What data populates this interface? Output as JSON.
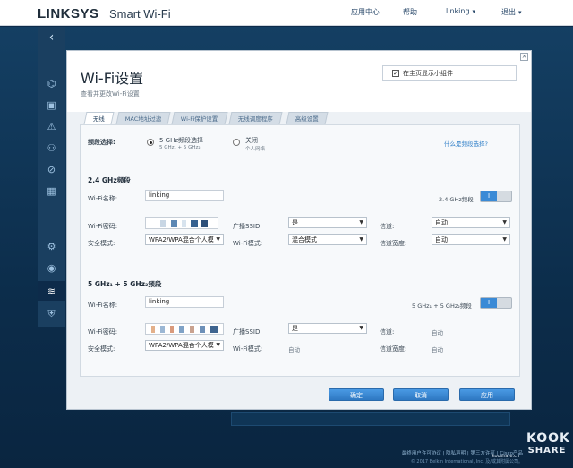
{
  "app": {
    "brand": "LINKSYS",
    "product": "Smart Wi-Fi"
  },
  "nav": {
    "app_center": "应用中心",
    "help": "帮助",
    "user": "linking",
    "logout": "退出"
  },
  "modal": {
    "title": "Wi-Fi设置",
    "subtitle": "查看并更改Wi-Fi设置",
    "widget_label": "在主页显示小组件",
    "tabs": [
      "无线",
      "MAC地址过滤",
      "Wi-Fi保护设置",
      "无线调度程序",
      "高级设置"
    ],
    "band_select_label": "频段选择:",
    "band_option1": "5 GHz频段选择",
    "band_option1_sub": "5 GHz₁ + 5 GHz₂",
    "band_option2": "关闭",
    "band_option2_sub": "个人网络",
    "band_help_link": "什么是频段选择?",
    "band24": {
      "heading": "2.4 GHz频段",
      "name_label": "Wi-Fi名称:",
      "name_value": "linking",
      "toggle_label": "2.4 GHz频段",
      "toggle_state": "I",
      "password_label": "Wi-Fi密码:",
      "ssid_broadcast_label": "广播SSID:",
      "ssid_broadcast_value": "是",
      "channel_label": "信道:",
      "channel_value": "自动",
      "security_label": "安全模式:",
      "security_value": "WPA2/WPA混合个人模",
      "mode_label": "Wi-Fi模式:",
      "mode_value": "混合模式",
      "width_label": "信道宽度:",
      "width_value": "自动"
    },
    "band5": {
      "heading": "5 GHz₁ + 5 GHz₂频段",
      "name_label": "Wi-Fi名称:",
      "name_value": "linking",
      "toggle_label": "5 GHz₁ + 5 GHz₂频段",
      "toggle_state": "I",
      "password_label": "Wi-Fi密码:",
      "ssid_broadcast_label": "广播SSID:",
      "ssid_broadcast_value": "是",
      "channel_label": "信道:",
      "channel_value": "自动",
      "security_label": "安全模式:",
      "security_value": "WPA2/WPA混合个人模",
      "mode_label": "Wi-Fi模式:",
      "mode_value": "自动",
      "width_label": "信道宽度:",
      "width_value": "自动"
    },
    "buttons": {
      "ok": "确定",
      "cancel": "取消",
      "apply": "应用"
    }
  },
  "footer": {
    "links": "最终用户许可协议 | 隐私声明 | 第三方许可 | Cisco产品",
    "copyright": "© 2017 Belkin International, Inc. 及/或其附属公司。"
  },
  "watermark": {
    "line1": "KOOK",
    "line2": "SHARE",
    "site": "kooshare.cn"
  },
  "colors": {
    "accent": "#3a8ad6",
    "page_bg": "#0d2b4a",
    "sidebar_bg": "#1a3f60"
  },
  "icons": [
    "back-arrow-icon",
    "network-map-icon",
    "devices-icon",
    "warning-icon",
    "parental-control-icon",
    "media-prioritization-icon",
    "speed-test-icon",
    "settings-gear-icon",
    "camera-icon",
    "wifi-icon",
    "security-shield-icon"
  ]
}
